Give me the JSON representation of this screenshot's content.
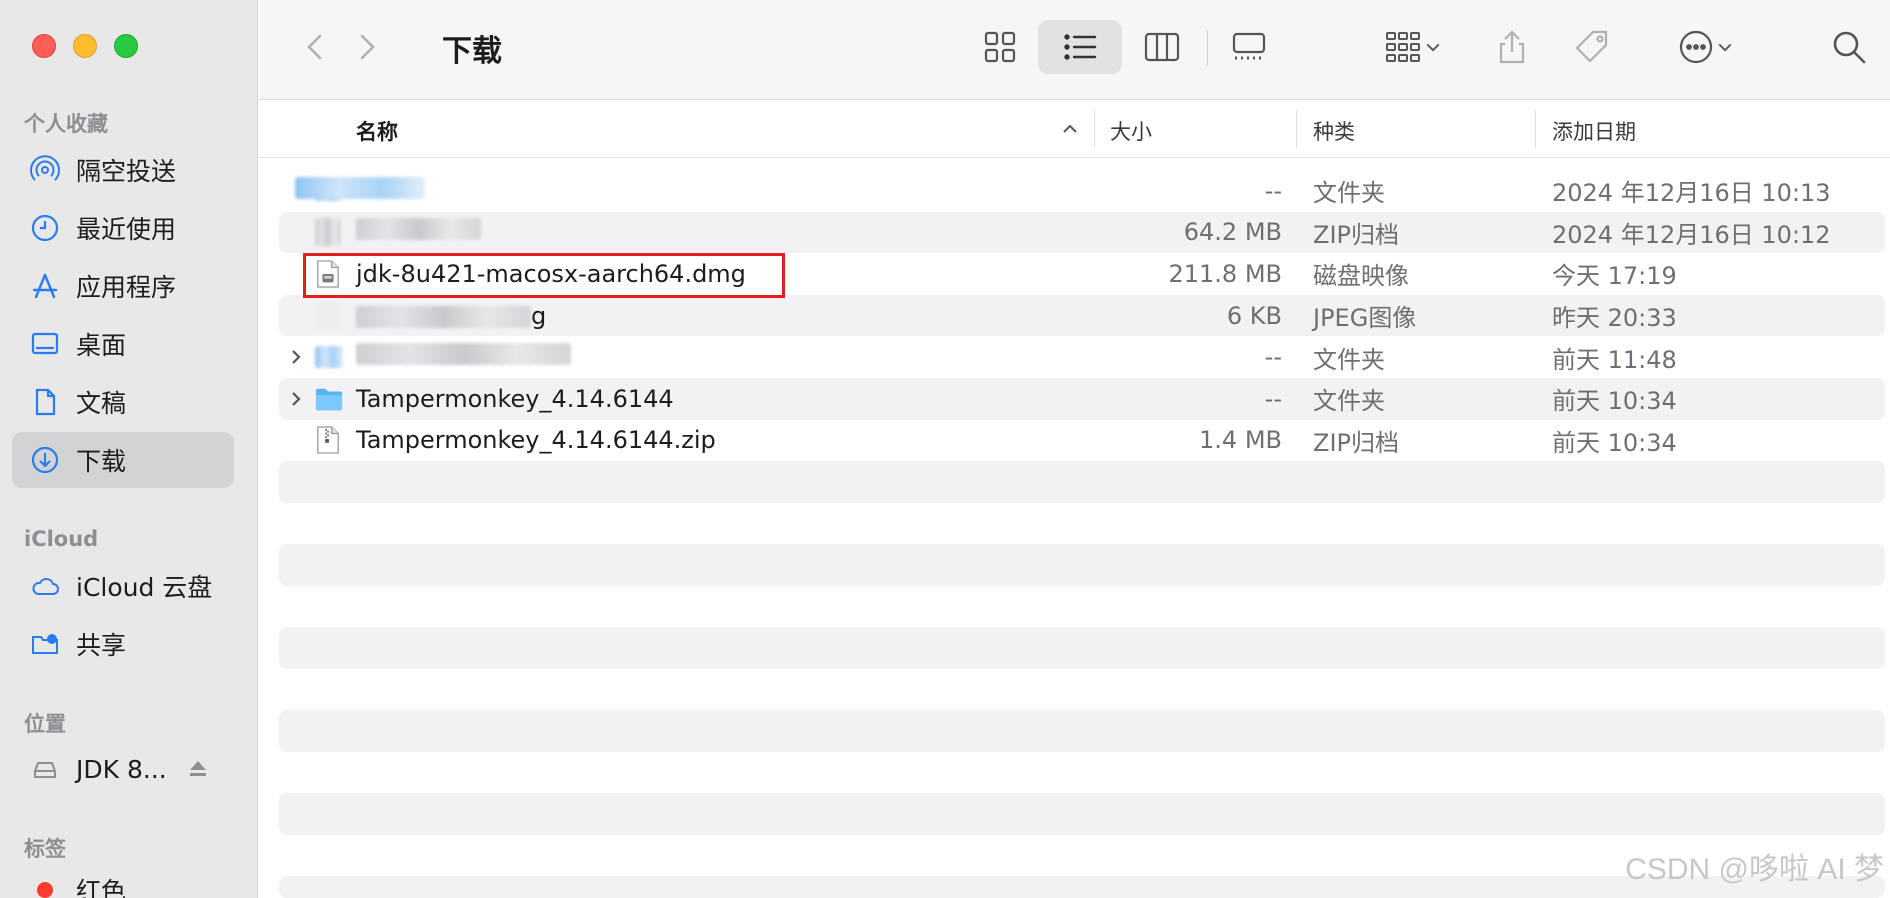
{
  "window": {
    "title": "下载",
    "watermark": "CSDN @哆啦 AI 梦"
  },
  "sidebar": {
    "favorites_header": "个人收藏",
    "favorites": [
      {
        "label": "隔空投送",
        "icon": "airdrop-icon"
      },
      {
        "label": "最近使用",
        "icon": "clock-icon"
      },
      {
        "label": "应用程序",
        "icon": "applications-icon"
      },
      {
        "label": "桌面",
        "icon": "desktop-icon"
      },
      {
        "label": "文稿",
        "icon": "document-icon"
      },
      {
        "label": "下载",
        "icon": "download-icon",
        "active": true
      }
    ],
    "icloud_header": "iCloud",
    "icloud": [
      {
        "label": "iCloud 云盘",
        "icon": "cloud-icon"
      },
      {
        "label": "共享",
        "icon": "shared-folder-icon"
      }
    ],
    "locations_header": "位置",
    "locations": [
      {
        "label": "JDK 8...",
        "icon": "drive-icon"
      }
    ],
    "tags_header": "标签",
    "tags": [
      {
        "label": "红色",
        "color": "#ff3b30"
      }
    ]
  },
  "columns": {
    "name": "名称",
    "size": "大小",
    "kind": "种类",
    "date": "添加日期"
  },
  "files": [
    {
      "name": "",
      "blurred": true,
      "type": "folder",
      "size": "--",
      "kind": "文件夹",
      "date": "2024 年12月16日 10:13"
    },
    {
      "name": "",
      "blurred": true,
      "type": "zip",
      "size": "64.2 MB",
      "kind": "ZIP归档",
      "date": "2024 年12月16日 10:12"
    },
    {
      "name": "jdk-8u421-macosx-aarch64.dmg",
      "blurred": false,
      "type": "dmg",
      "size": "211.8 MB",
      "kind": "磁盘映像",
      "date": "今天 17:19",
      "highlighted": true
    },
    {
      "name": "g",
      "blurred": true,
      "type": "jpeg",
      "size": "6 KB",
      "kind": "JPEG图像",
      "date": "昨天 20:33"
    },
    {
      "name": "",
      "blurred": true,
      "type": "folder",
      "size": "--",
      "kind": "文件夹",
      "date": "前天 11:48",
      "expandable": true
    },
    {
      "name": "Tampermonkey_4.14.6144",
      "blurred": false,
      "type": "folder",
      "size": "--",
      "kind": "文件夹",
      "date": "前天 10:34",
      "expandable": true
    },
    {
      "name": "Tampermonkey_4.14.6144.zip",
      "blurred": false,
      "type": "zip",
      "size": "1.4 MB",
      "kind": "ZIP归档",
      "date": "前天 10:34"
    }
  ]
}
